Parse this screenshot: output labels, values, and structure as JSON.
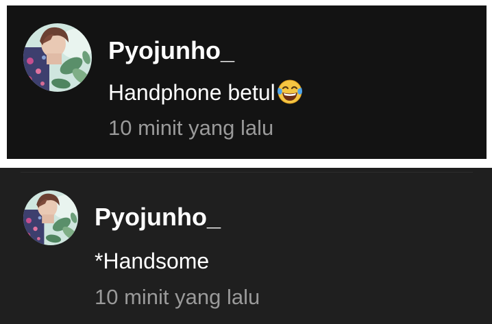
{
  "comments": [
    {
      "username": "Pyojunho_",
      "message": "Handphone betul",
      "emoji": "tears-of-joy-emoji",
      "time": "10 minit yang lalu"
    },
    {
      "username": "Pyojunho_",
      "message": "*Handsome",
      "time": "10 minit yang lalu"
    }
  ]
}
